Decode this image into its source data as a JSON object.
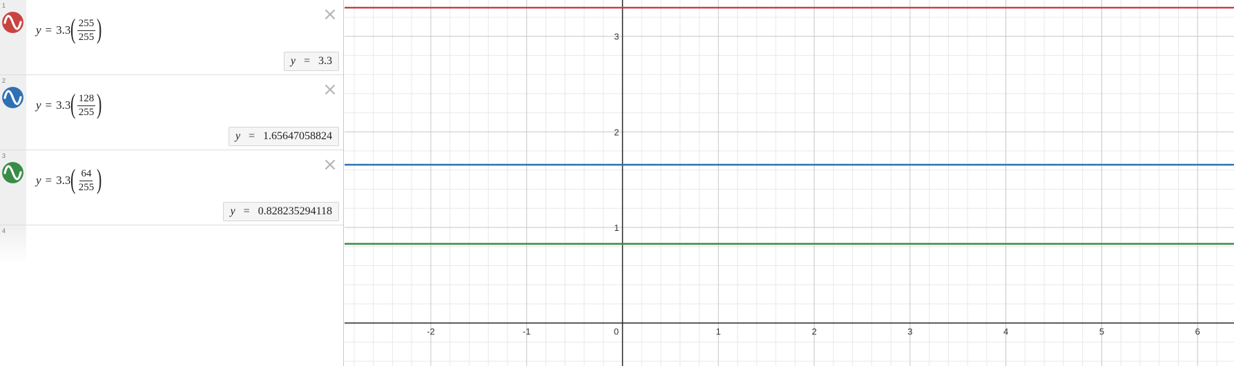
{
  "expressions": [
    {
      "index": "1",
      "color": "#c74440",
      "lhs": "y",
      "coef": "3.3",
      "numerator": "255",
      "denominator": "255",
      "result_var": "y",
      "result_value": "3.3",
      "value": 3.3
    },
    {
      "index": "2",
      "color": "#2d70b3",
      "lhs": "y",
      "coef": "3.3",
      "numerator": "128",
      "denominator": "255",
      "result_var": "y",
      "result_value": "1.65647058824",
      "value": 1.65647058824
    },
    {
      "index": "3",
      "color": "#388c46",
      "lhs": "y",
      "coef": "3.3",
      "numerator": "64",
      "denominator": "255",
      "result_var": "y",
      "result_value": "0.828235294118",
      "value": 0.828235294118
    }
  ],
  "empty_expression": {
    "index": "4"
  },
  "icons": {
    "graph_toggle": "sine-wave-icon",
    "delete": "close-icon"
  },
  "graph": {
    "x_ticks": [
      "-2",
      "-1",
      "0",
      "1",
      "2",
      "3",
      "4",
      "5",
      "6"
    ],
    "y_ticks": [
      "1",
      "2",
      "3"
    ],
    "x_range": [
      -2.9,
      6.38
    ],
    "y_range": [
      -0.45,
      3.38
    ],
    "grid_color": "#e8e8e8",
    "major_grid_color": "#c6c6c6",
    "axis_color": "#222222"
  }
}
